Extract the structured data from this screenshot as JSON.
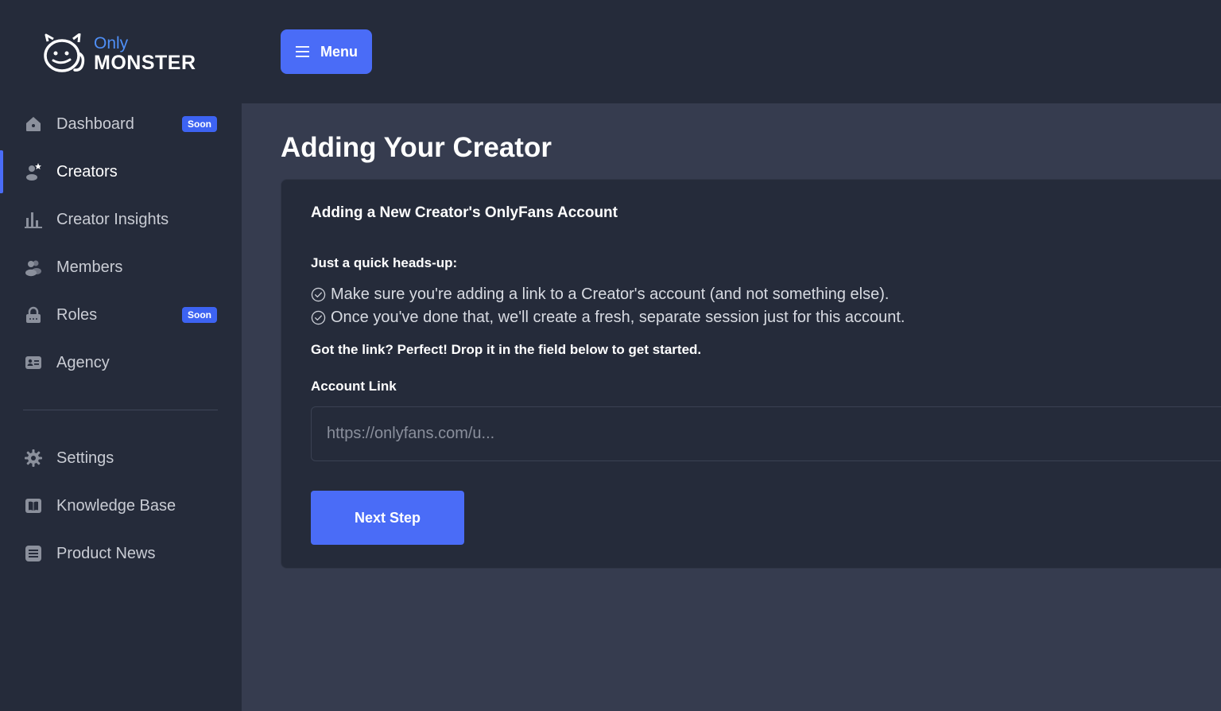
{
  "brand": {
    "line1": "Only",
    "line2": "MONSTER",
    "accent_color": "#4f8ff7"
  },
  "sidebar": {
    "items": [
      {
        "label": "Dashboard",
        "icon": "home-icon",
        "badge": "Soon",
        "active": false
      },
      {
        "label": "Creators",
        "icon": "creator-star-icon",
        "badge": null,
        "active": true
      },
      {
        "label": "Creator Insights",
        "icon": "bar-chart-icon",
        "badge": null,
        "active": false
      },
      {
        "label": "Members",
        "icon": "users-icon",
        "badge": null,
        "active": false
      },
      {
        "label": "Roles",
        "icon": "lock-icon",
        "badge": "Soon",
        "active": false
      },
      {
        "label": "Agency",
        "icon": "id-card-icon",
        "badge": null,
        "active": false
      }
    ],
    "secondary_items": [
      {
        "label": "Settings",
        "icon": "gear-icon"
      },
      {
        "label": "Knowledge Base",
        "icon": "book-icon"
      },
      {
        "label": "Product News",
        "icon": "list-icon"
      }
    ]
  },
  "topbar": {
    "menu_label": "Menu"
  },
  "main": {
    "page_title": "Adding Your Creator",
    "card": {
      "title": "Adding a New Creator's OnlyFans Account",
      "headsup": "Just a quick heads-up:",
      "checklist": [
        "Make sure you're adding a link to a Creator's account (and not something else).",
        "Once you've done that, we'll create a fresh, separate session just for this account."
      ],
      "instruction": "Got the link? Perfect! Drop it in the field below to get started.",
      "field_label": "Account Link",
      "input_placeholder": "https://onlyfans.com/u...",
      "input_value": "",
      "submit_label": "Next Step"
    }
  },
  "colors": {
    "primary": "#4a6cf7",
    "sidebar_bg": "#252b3a",
    "page_bg": "#363c4f",
    "card_bg": "#252b3a"
  }
}
